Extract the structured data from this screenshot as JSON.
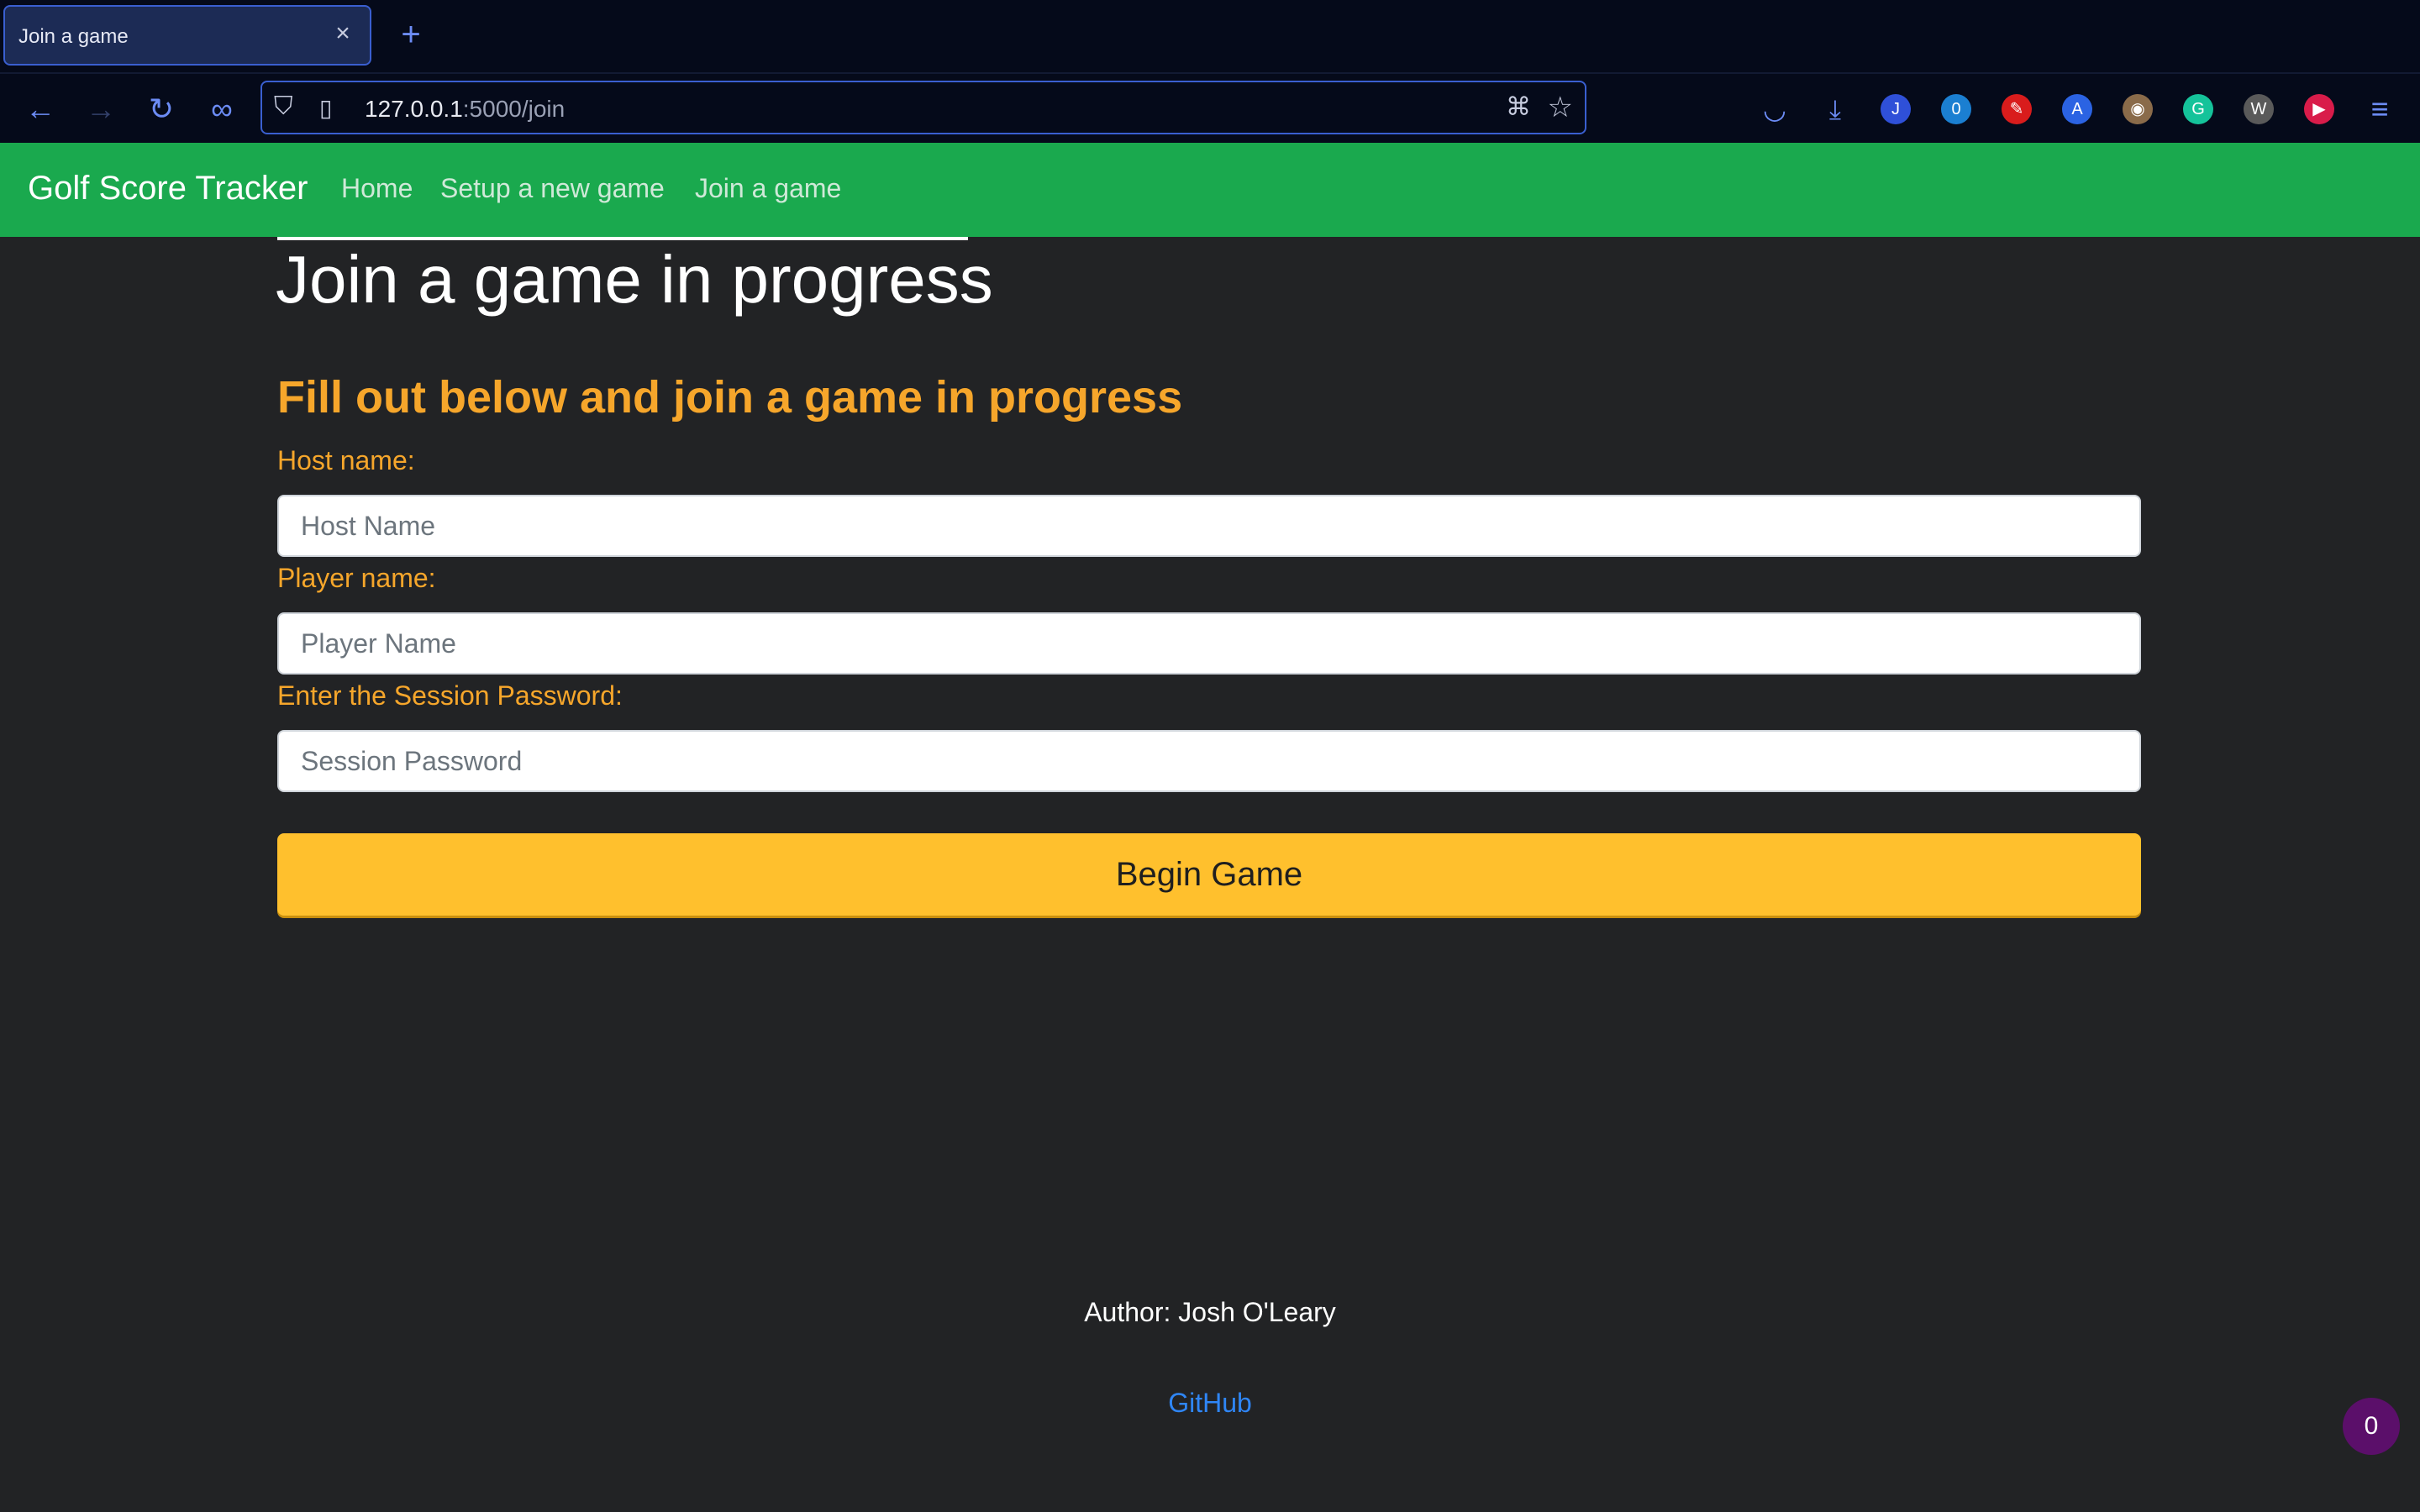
{
  "browser": {
    "tab_title": "Join a game",
    "tab_close_icon": "close-icon",
    "new_tab_icon": "plus-icon",
    "url_host": "127.0.0.1",
    "url_rest": ":5000/join",
    "extensions": [
      {
        "name": "pocket-icon",
        "glyph": "◡",
        "color": "#6c8cf5"
      },
      {
        "name": "download-icon",
        "glyph": "⤓",
        "color": "#6c8cf5"
      },
      {
        "name": "extension-j-icon",
        "glyph": "J",
        "color": "#2f50d8"
      },
      {
        "name": "extension-counter-icon",
        "glyph": "0",
        "color": "#1b7fd1"
      },
      {
        "name": "extension-red-icon",
        "glyph": "✎",
        "color": "#d91c1c"
      },
      {
        "name": "translate-icon",
        "glyph": "A",
        "color": "#2b63e3"
      },
      {
        "name": "extension-owl-icon",
        "glyph": "◉",
        "color": "#8a6b4a"
      },
      {
        "name": "grammarly-icon",
        "glyph": "G",
        "color": "#15c39a"
      },
      {
        "name": "extension-w-icon",
        "glyph": "W",
        "color": "#5a5a5a"
      },
      {
        "name": "extension-play-icon",
        "glyph": "▶",
        "color": "#d91c4a"
      }
    ],
    "menu_icon": "hamburger-menu-icon"
  },
  "navbar": {
    "brand": "Golf Score Tracker",
    "links": [
      "Home",
      "Setup a new game",
      "Join a game"
    ]
  },
  "main": {
    "title": "Join a game in progress",
    "subtitle": "Fill out below and join a game in progress",
    "host_label": "Host name:",
    "host_placeholder": "Host Name",
    "player_label": "Player name:",
    "player_placeholder": "Player Name",
    "password_label": "Enter the Session Password:",
    "password_placeholder": "Session Password",
    "submit_label": "Begin Game"
  },
  "footer": {
    "author": "Author: Josh O'Leary",
    "github": "GitHub"
  },
  "badge": {
    "count": "0"
  },
  "colors": {
    "navbar_green": "#1aa94e",
    "accent_orange": "#f6a62b",
    "button_yellow": "#ffc02d",
    "background": "#222325"
  }
}
